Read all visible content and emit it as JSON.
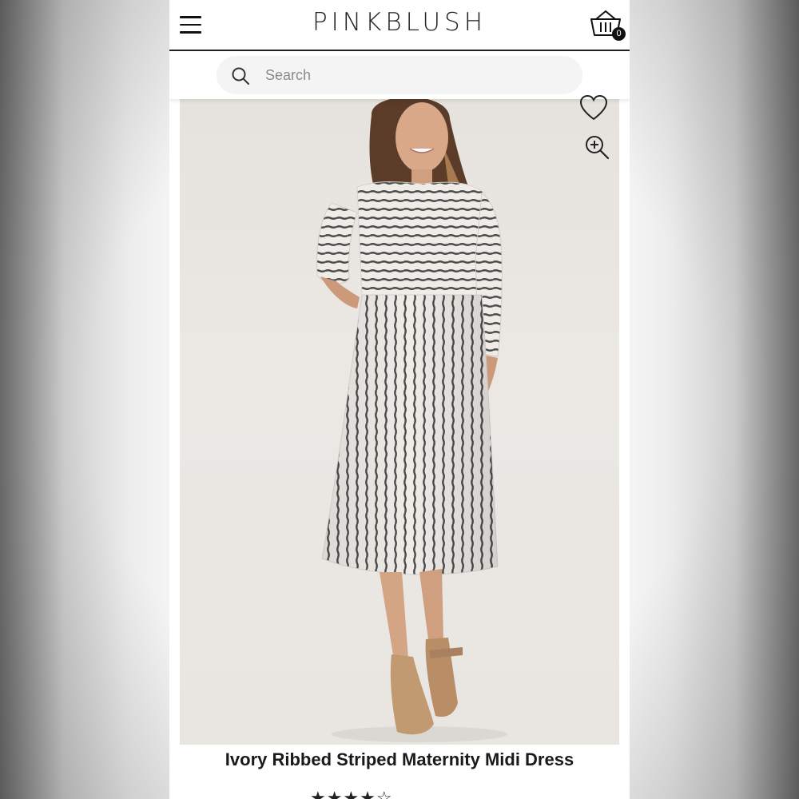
{
  "header": {
    "logo": "PINKBLUSH",
    "menu_icon": "hamburger-menu-icon",
    "cart_icon": "shopping-basket-icon",
    "cart_count": "0"
  },
  "search": {
    "placeholder": "Search",
    "icon": "search-icon"
  },
  "product": {
    "image_alt": "Model wearing ivory ribbed striped midi dress",
    "favorite_icon": "heart-icon",
    "zoom_icon": "zoom-in-icon",
    "title": "Ivory Ribbed Striped Maternity Midi Dress",
    "rating_stars": "★★★★☆",
    "rating": 4
  },
  "colors": {
    "text": "#1a1a1a",
    "accent": "#111111",
    "photo_background": "#e9e6e2"
  }
}
